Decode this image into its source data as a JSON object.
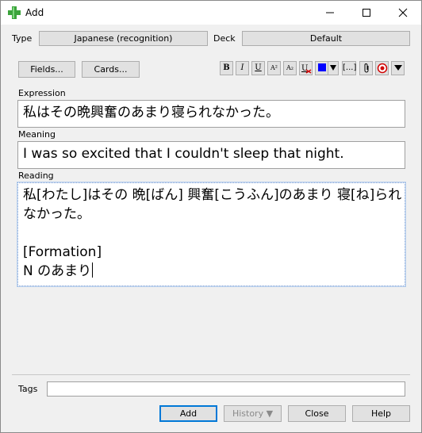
{
  "window": {
    "title": "Add",
    "icons": {
      "app": "plus-icon",
      "minimize": "minimize-icon",
      "maximize": "maximize-icon",
      "close": "close-icon"
    }
  },
  "top_row": {
    "type_label": "Type",
    "type_value": "Japanese (recognition)",
    "deck_label": "Deck",
    "deck_value": "Default"
  },
  "toolbar": {
    "fields_button": "Fields...",
    "cards_button": "Cards...",
    "bold": "B",
    "italic": "I",
    "underline": "U",
    "superscript": "A²",
    "subscript": "A₂",
    "cloze": "[...]",
    "icon_names": [
      "text-color-icon",
      "color-dropdown-icon",
      "attach-icon",
      "record-icon",
      "more-dropdown-icon"
    ],
    "text_color": "#0000ff",
    "record_color": "#d00000"
  },
  "fields": {
    "expression": {
      "label": "Expression",
      "value": "私はその晩興奮のあまり寝られなかった。"
    },
    "meaning": {
      "label": "Meaning",
      "value": "I was so excited that I couldn't sleep that night."
    },
    "reading": {
      "label": "Reading",
      "lines": [
        "私[わたし]はその 晩[ばん] 興奮[こうふん]のあまり 寝[ね]られ",
        "なかった。",
        "",
        "[Formation]",
        "N のあまり"
      ]
    }
  },
  "tags": {
    "label": "Tags",
    "value": ""
  },
  "bottom_buttons": {
    "add": "Add",
    "history": "History ▼",
    "close": "Close",
    "help": "Help"
  }
}
